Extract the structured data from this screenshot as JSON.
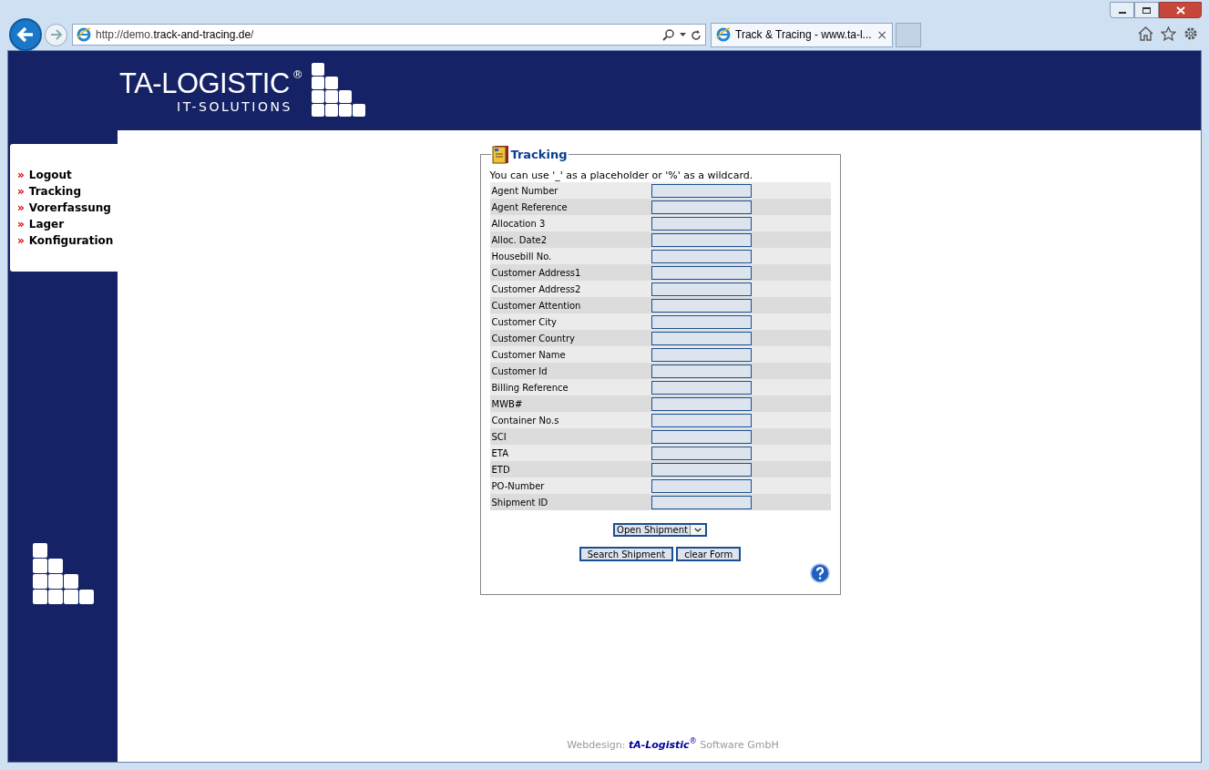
{
  "browser": {
    "url_prefix": "http://demo.",
    "url_domain": "track-and-tracing.de",
    "url_suffix": "/",
    "tab": {
      "title": "Track & Tracing - www.ta-l...",
      "close": "×",
      "selected": true
    }
  },
  "logo": {
    "name": "TA-LOGISTIC",
    "mark": "®",
    "subtitle": "IT-SOLUTIONS"
  },
  "menu": [
    {
      "bullet": "»",
      "label": "Logout"
    },
    {
      "bullet": "»",
      "label": "Tracking"
    },
    {
      "bullet": "»",
      "label": "Vorerfassung"
    },
    {
      "bullet": "»",
      "label": "Lager"
    },
    {
      "bullet": "»",
      "label": "Konfiguration"
    }
  ],
  "form": {
    "legend": "Tracking",
    "hint": "You can use '_' as a placeholder or '%' as a wildcard.",
    "fields": [
      "Agent Number",
      "Agent Reference",
      "Allocation 3",
      "Alloc. Date2",
      "Housebill No.",
      "Customer Address1",
      "Customer Address2",
      "Customer Attention",
      "Customer City",
      "Customer Country",
      "Customer Name",
      "Customer Id",
      "Billing Reference",
      "MWB#",
      "Container No.s",
      "SCI",
      "ETA",
      "ETD",
      "PO-Number",
      "Shipment ID"
    ],
    "select": "Open Shipment",
    "buttons": [
      "Search Shipment",
      "clear Form"
    ]
  },
  "footer": "Webdesign: **tA-Logistic**$^{®}$ Software GmbH"
}
